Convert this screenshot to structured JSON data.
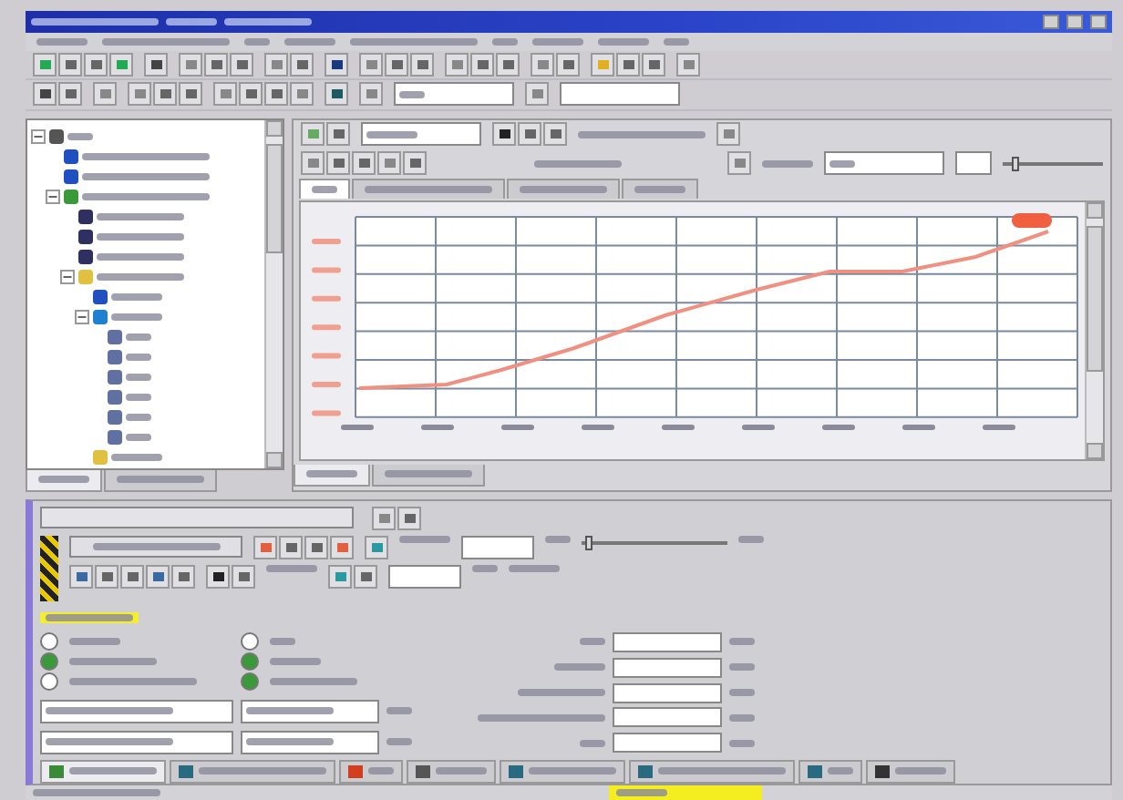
{
  "tree": {
    "items": [
      {
        "kind": "project",
        "expanded": true,
        "children": [
          {
            "kind": "blue"
          },
          {
            "kind": "blue"
          },
          {
            "kind": "device",
            "expanded": true,
            "children": [
              {
                "kind": "dark"
              },
              {
                "kind": "dark"
              },
              {
                "kind": "dark"
              },
              {
                "kind": "folder",
                "expanded": true,
                "children": [
                  {
                    "kind": "blue"
                  },
                  {
                    "kind": "axis",
                    "expanded": true,
                    "children": [
                      {
                        "kind": "leaf"
                      },
                      {
                        "kind": "leaf"
                      },
                      {
                        "kind": "leaf"
                      },
                      {
                        "kind": "leaf"
                      },
                      {
                        "kind": "leaf"
                      },
                      {
                        "kind": "leaf"
                      }
                    ]
                  },
                  {
                    "kind": "folder"
                  }
                ]
              }
            ]
          }
        ]
      }
    ]
  },
  "left_tabs": [
    {
      "selected": true
    },
    {
      "selected": false
    }
  ],
  "trace_tabs": [
    {
      "selected": true
    },
    {
      "selected": false
    },
    {
      "selected": false
    },
    {
      "selected": false
    }
  ],
  "zoom_slider": {
    "level": 0.12
  },
  "view_tabs": [
    {
      "selected": true
    },
    {
      "selected": false
    }
  ],
  "bottom_slider": {
    "level": 0.05
  },
  "radios": [
    {
      "selected": false
    },
    {
      "selected": true
    },
    {
      "selected": false
    },
    {
      "selected": false
    },
    {
      "selected": true
    },
    {
      "selected": true
    }
  ],
  "task_tabs": [
    {
      "selected": true
    },
    {
      "selected": false
    },
    {
      "selected": false
    },
    {
      "selected": false
    },
    {
      "selected": false
    },
    {
      "selected": false
    },
    {
      "selected": false
    },
    {
      "selected": false
    }
  ]
}
